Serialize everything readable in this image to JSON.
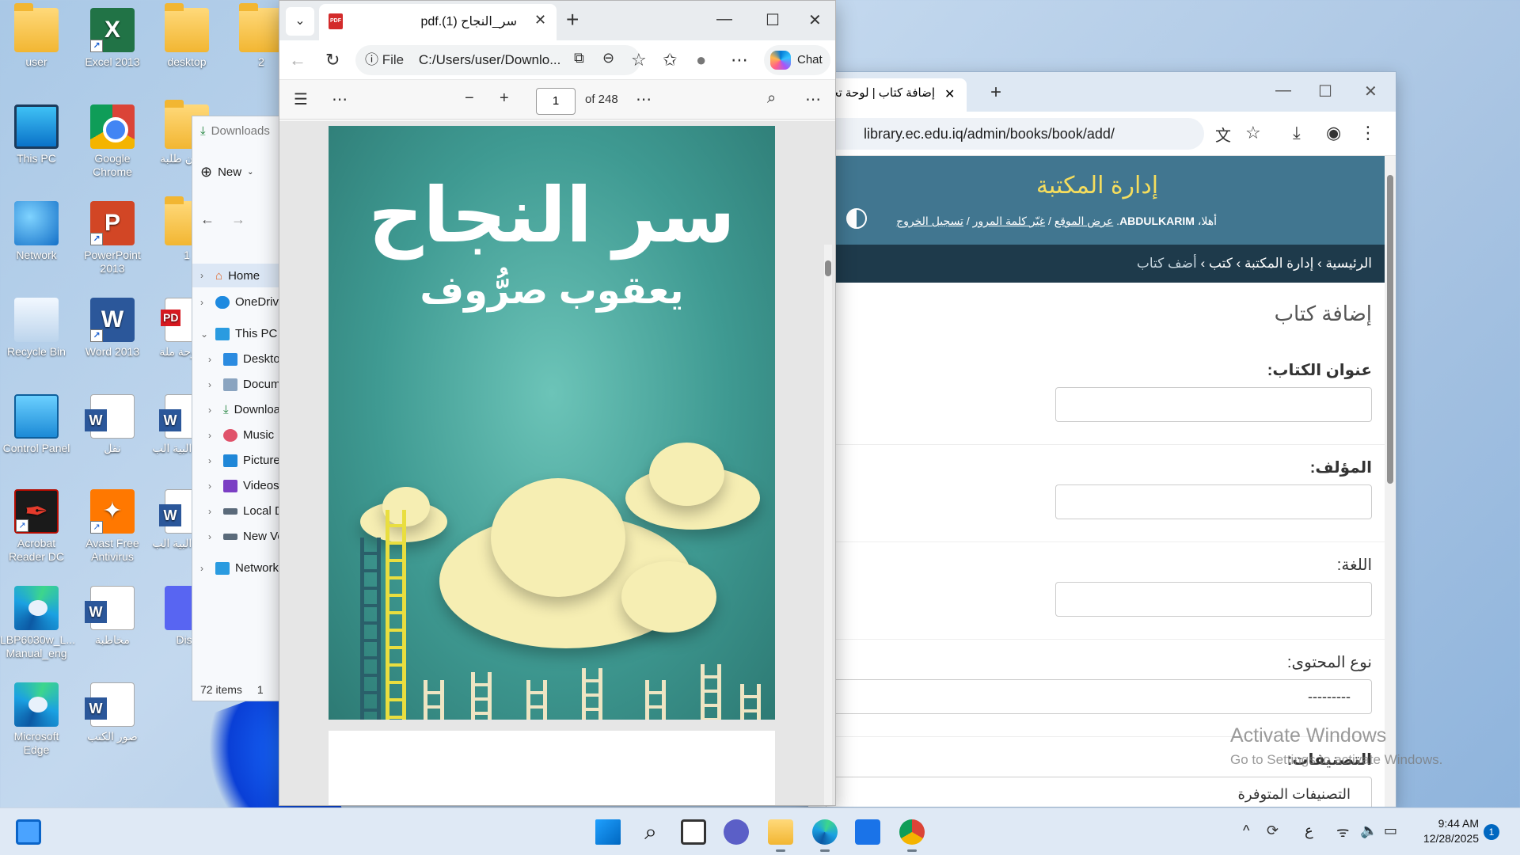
{
  "desktop": {
    "icons": [
      {
        "label": "user"
      },
      {
        "label": "Excel 2013"
      },
      {
        "label": "desktop"
      },
      {
        "label": "2"
      },
      {
        "label": "This PC"
      },
      {
        "label": "Google Chrome"
      },
      {
        "label": "شؤون طلبة"
      },
      {
        "label": "Network"
      },
      {
        "label": "PowerPoint 2013"
      },
      {
        "label": "1"
      },
      {
        "label": "Recycle Bin"
      },
      {
        "label": "Word 2013"
      },
      {
        "label": "اطروحة ملة"
      },
      {
        "label": "Control Panel"
      },
      {
        "label": "نقل"
      },
      {
        "label": "مراكز البية الب"
      },
      {
        "label": "Acrobat Reader DC"
      },
      {
        "label": "Avast Free Antivirus"
      },
      {
        "label": "مراكز البية الب"
      },
      {
        "label": "LBP6030w_L... Manual_eng"
      },
      {
        "label": "مخاطبة"
      },
      {
        "label": "Disc"
      },
      {
        "label": "Microsoft Edge"
      },
      {
        "label": "صور الكتب"
      }
    ]
  },
  "explorer": {
    "address": "Downloads",
    "new_label": "New",
    "nav": [
      "Home",
      "OneDrive",
      "This PC",
      "Desktop",
      "Documents",
      "Downloads",
      "Music",
      "Pictures",
      "Videos",
      "Local Disk",
      "New Volume",
      "Network"
    ],
    "status": "72 items",
    "status_extra": "1"
  },
  "edge": {
    "tab_title": "سر_النجاح (1).pdf",
    "url_scheme": "File",
    "url": "C:/Users/user/Downlo...",
    "chat_label": "Chat",
    "page_number": "1",
    "page_total": "of 248",
    "pdf": {
      "title": "سر النجاح",
      "author": "يعقوب صرُّوف"
    }
  },
  "chrome": {
    "tab_title": "إضافة كتاب | لوحة تحكم",
    "url": "library.ec.edu.iq/admin/books/book/add/",
    "admin": {
      "brand": "إدارة المكتبة",
      "welcome": "أهلا،",
      "user": "ABDULKARIM",
      "view_site": "عرض الموقع",
      "change_password": "غيّر كلمة المرور",
      "logout": "تسجيل الخروج",
      "sep": "/"
    },
    "breadcrumbs": [
      "الرئيسية",
      "إدارة المكتبة",
      "كتب",
      "أضف كتاب"
    ],
    "crumb_sep": "›",
    "form_title": "إضافة كتاب",
    "fields": [
      {
        "label": "عنوان الكتاب:",
        "type": "text",
        "value": ""
      },
      {
        "label": "المؤلف:",
        "type": "text",
        "value": ""
      },
      {
        "label": "اللغة:",
        "type": "text",
        "value": ""
      },
      {
        "label": "نوع المحتوى:",
        "type": "select",
        "value": "---------"
      },
      {
        "label": "التصنيفات:",
        "type": "select",
        "value": "التصنيفات المتوفرة"
      }
    ]
  },
  "watermark": {
    "line1": "Activate Windows",
    "line2": "Go to Settings to activate Windows."
  },
  "taskbar": {
    "time": "9:44 AM",
    "date": "12/28/2025",
    "lang": "ع",
    "notifications": "1"
  },
  "colors": {
    "admin_header": "#417690",
    "admin_brand": "#f5dd5d",
    "breadcrumb_bg": "#1e3a4b",
    "pdf_cover": "#3f9a92"
  }
}
